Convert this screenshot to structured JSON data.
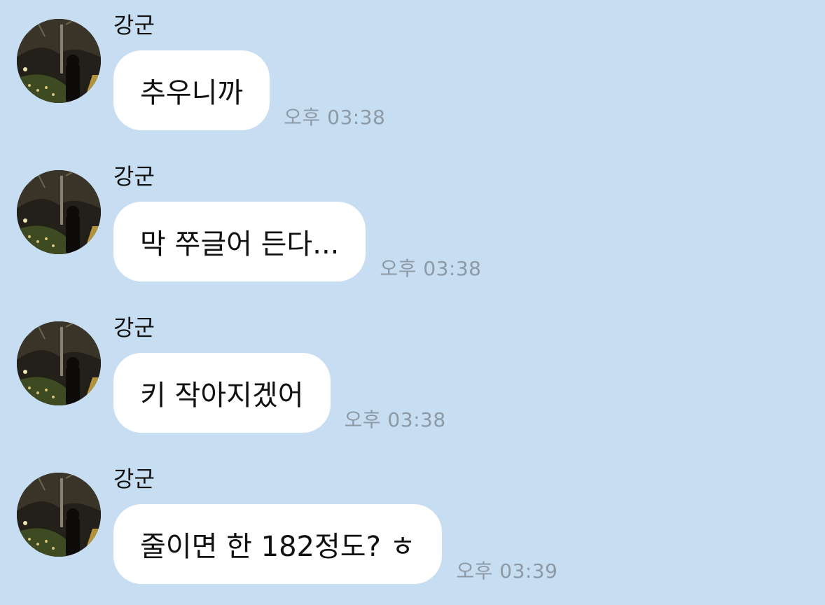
{
  "chat": {
    "background_color": "#c7ddf2",
    "bubble_color": "#ffffff",
    "messages": [
      {
        "sender": "강군",
        "text": "추우니까",
        "time": "오후 03:38"
      },
      {
        "sender": "강군",
        "text": "막 쭈글어 든다...",
        "time": "오후 03:38"
      },
      {
        "sender": "강군",
        "text": "키 작아지겠어",
        "time": "오후 03:38"
      },
      {
        "sender": "강군",
        "text": "줄이면 한 182정도? ㅎ",
        "time": "오후 03:39"
      }
    ]
  },
  "avatar": {
    "icon": "profile-photo-night-street"
  }
}
